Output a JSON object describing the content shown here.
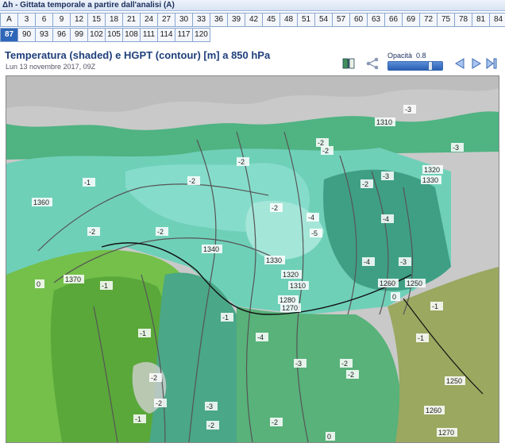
{
  "header": {
    "title": "Δh - Gittata temporale a partire dall'analisi (A)"
  },
  "steps_row1": [
    "A",
    "3",
    "6",
    "9",
    "12",
    "15",
    "18",
    "21",
    "24",
    "27",
    "30",
    "33",
    "36",
    "39",
    "42",
    "45",
    "48",
    "51",
    "54",
    "57",
    "60",
    "63",
    "66",
    "69",
    "72",
    "75",
    "78",
    "81",
    "84"
  ],
  "steps_row2": [
    "87",
    "90",
    "93",
    "96",
    "99",
    "102",
    "105",
    "108",
    "111",
    "114",
    "117",
    "120"
  ],
  "selected_step": "87",
  "chart": {
    "title": "Temperatura (shaded) e HGPT (contour) [m] a 850 hPa",
    "date": "Lun 13 novembre 2017, 09Z"
  },
  "controls": {
    "opacity_label": "Opacità",
    "opacity_value": "0.8",
    "opacity_fraction": 0.8,
    "icons": [
      "book-icon",
      "share-icon",
      "play-back-icon",
      "play-forward-icon",
      "skip-forward-icon"
    ]
  },
  "map": {
    "temperature_labels": [
      "-1",
      "-1",
      "-2",
      "-2",
      "-2",
      "-2",
      "-2",
      "-2",
      "-2",
      "-2",
      "-3",
      "-3",
      "-3",
      "-4",
      "-4",
      "-4",
      "-4",
      "-5",
      "-3",
      "-3",
      "-2",
      "-2",
      "-1",
      "0",
      "0",
      "0",
      "-2",
      "-2",
      "-3",
      "-2",
      "-1",
      "-2",
      "-1",
      "-1",
      "-1"
    ],
    "height_labels": [
      "1360",
      "1370",
      "1340",
      "1330",
      "1320",
      "1310",
      "1280",
      "1270",
      "1260",
      "1250",
      "1250",
      "1260",
      "1270",
      "1310",
      "1320",
      "1330"
    ],
    "colors": {
      "land_grey": "#c8c8c8",
      "teal_dark": "#3f9f85",
      "teal_light": "#6fd0b8",
      "green": "#74c04a",
      "olive": "#9aa860",
      "sea_green": "#58b27a"
    }
  }
}
